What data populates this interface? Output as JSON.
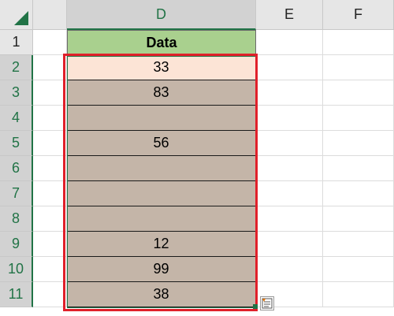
{
  "columns": [
    {
      "label": "D"
    },
    {
      "label": "E"
    },
    {
      "label": "F"
    }
  ],
  "rows": [
    "1",
    "2",
    "3",
    "4",
    "5",
    "6",
    "7",
    "8",
    "9",
    "10",
    "11"
  ],
  "header_cell": "Data",
  "data_cells": [
    "33",
    "83",
    "",
    "56",
    "",
    "",
    "",
    "12",
    "99",
    "38"
  ],
  "colors": {
    "header_fill": "#a9d08e",
    "first_fill": "#fce4d6",
    "data_fill": "#c4b5a8",
    "selection_outline": "#e0202a",
    "excel_green": "#217346"
  },
  "icons": {
    "quick_analysis": "quick-analysis-icon"
  }
}
